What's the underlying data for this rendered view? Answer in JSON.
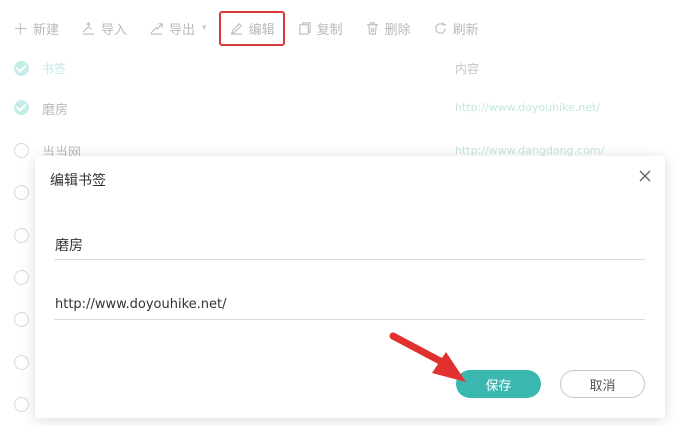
{
  "toolbar": {
    "new_label": "新建",
    "import_label": "导入",
    "export_label": "导出",
    "edit_label": "编辑",
    "copy_label": "复制",
    "delete_label": "删除",
    "refresh_label": "刷新"
  },
  "list": {
    "header_name": "书签",
    "header_content": "内容",
    "rows": [
      {
        "name": "磨房",
        "url": "http://www.doyouhike.net/",
        "checked": true
      },
      {
        "name": "当当网",
        "url": "http://www.dangdang.com/",
        "checked": false
      }
    ]
  },
  "dialog": {
    "title": "编辑书签",
    "name_value": "磨房",
    "url_value": "http://www.doyouhike.net/",
    "save_label": "保存",
    "cancel_label": "取消"
  },
  "colors": {
    "accent": "#3ab8b0",
    "highlight_box": "#d9383a",
    "annotation_arrow": "#e0312f"
  }
}
